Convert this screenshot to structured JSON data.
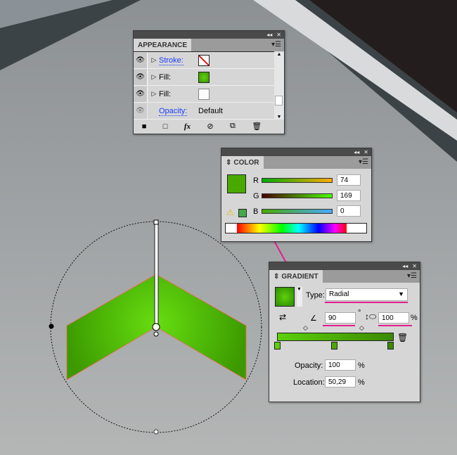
{
  "appearance": {
    "title": "APPEARANCE",
    "rows": [
      {
        "label": "Stroke:",
        "swatch": "none"
      },
      {
        "label": "Fill:",
        "swatch": "radial-green"
      },
      {
        "label": "Fill:",
        "swatch": "transparent"
      },
      {
        "label": "Opacity:",
        "value": "Default"
      }
    ],
    "footer_fx": "fx"
  },
  "color": {
    "title": "COLOR",
    "channels": [
      {
        "label": "R",
        "value": "74"
      },
      {
        "label": "G",
        "value": "169"
      },
      {
        "label": "B",
        "value": "0"
      }
    ],
    "swatch": "#4aa900"
  },
  "gradient": {
    "title": "GRADIENT",
    "type_label": "Type:",
    "type_value": "Radial",
    "angle": "90",
    "degree": "°",
    "aspect": "100",
    "percent": "%",
    "opacity_label": "Opacity:",
    "opacity": "100",
    "location_label": "Location:",
    "location": "50,29",
    "colors": {
      "start": "#5ccf0e",
      "end": "#3c8a00"
    }
  },
  "colors": {
    "accent": "#e0208c",
    "fill": "#4aa900"
  }
}
